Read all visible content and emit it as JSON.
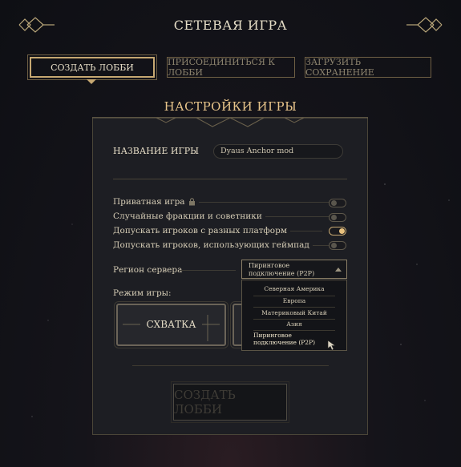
{
  "header": {
    "title": "СЕТЕВАЯ ИГРА"
  },
  "tabs": [
    {
      "label": "СОЗДАТЬ ЛОББИ",
      "active": true
    },
    {
      "label": "ПРИСОЕДИНИТЬСЯ К ЛОББИ",
      "active": false
    },
    {
      "label": "ЗАГРУЗИТЬ СОХРАНЕНИЕ",
      "active": false
    }
  ],
  "settings": {
    "title": "НАСТРОЙКИ ИГРЫ",
    "game_name_label": "НАЗВАНИЕ ИГРЫ",
    "game_name_value": "Dyaus Anchor mod",
    "options": [
      {
        "label": "Приватная игра",
        "locked": true,
        "enabled": false
      },
      {
        "label": "Случайные фракции и советники",
        "enabled": false
      },
      {
        "label": "Допускать игроков с разных платформ",
        "enabled": true
      },
      {
        "label": "Допускать игроков, использующих геймпад",
        "enabled": false
      }
    ],
    "region_label": "Регион сервера",
    "region_selected": "Пиринговое подключение (P2P)",
    "region_options": [
      "Северная Америка",
      "Европа",
      "Материковый Китай",
      "Азия",
      "Пиринговое подключение (P2P)"
    ],
    "mode_label": "Режим игры:",
    "modes": [
      "СХВАТКА"
    ],
    "create_button": "СОЗДАТЬ ЛОББИ"
  },
  "colors": {
    "accent": "#c6a872",
    "title_gold": "#e7c48a",
    "toggle_on": "#e9c27e"
  },
  "icons": [
    "ornament-left-icon",
    "ornament-right-icon",
    "lock-icon",
    "chevron-up-icon",
    "cursor-icon"
  ]
}
